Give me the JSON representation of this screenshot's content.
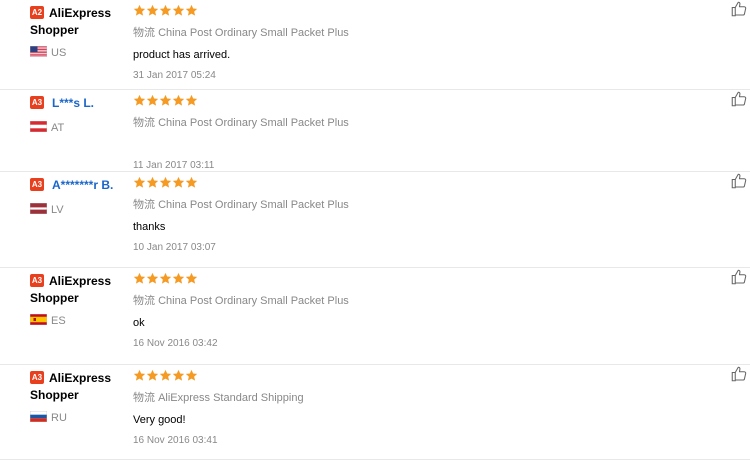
{
  "reviews": [
    {
      "badge": "A2",
      "name_line1": "AliExpress",
      "name_line2": "Shopper",
      "name_style": "plain",
      "country": "US",
      "flag": "us",
      "rating": 5,
      "shipping_label": "物流",
      "shipping_method": "China Post Ordinary Small Packet Plus",
      "feedback": "product has arrived.",
      "date": "31 Jan 2017 05:24"
    },
    {
      "badge": "A3",
      "name_line1": "L***s L.",
      "name_line2": "",
      "name_style": "link",
      "country": "AT",
      "flag": "at",
      "rating": 5,
      "shipping_label": "物流",
      "shipping_method": "China Post Ordinary Small Packet Plus",
      "feedback": "",
      "date": "11 Jan 2017 03:11"
    },
    {
      "badge": "A3",
      "name_line1": "A*******r B.",
      "name_line2": "",
      "name_style": "link",
      "country": "LV",
      "flag": "lv",
      "rating": 5,
      "shipping_label": "物流",
      "shipping_method": "China Post Ordinary Small Packet Plus",
      "feedback": "thanks",
      "date": "10 Jan 2017 03:07"
    },
    {
      "badge": "A3",
      "name_line1": "AliExpress",
      "name_line2": "Shopper",
      "name_style": "plain",
      "country": "ES",
      "flag": "es",
      "rating": 5,
      "shipping_label": "物流",
      "shipping_method": "China Post Ordinary Small Packet Plus",
      "feedback": "ok",
      "date": "16 Nov 2016 03:42"
    },
    {
      "badge": "A3",
      "name_line1": "AliExpress",
      "name_line2": "Shopper",
      "name_style": "plain",
      "country": "RU",
      "flag": "ru",
      "rating": 5,
      "shipping_label": "物流",
      "shipping_method": "AliExpress Standard Shipping",
      "feedback": "Very good!",
      "date": "16 Nov 2016 03:41"
    }
  ],
  "colors": {
    "star": "#f59a23",
    "badge": "#e8401f",
    "link": "#1b66c9"
  },
  "icons": {
    "rating_star": "star-icon",
    "helpful": "thumbs-up-icon"
  }
}
